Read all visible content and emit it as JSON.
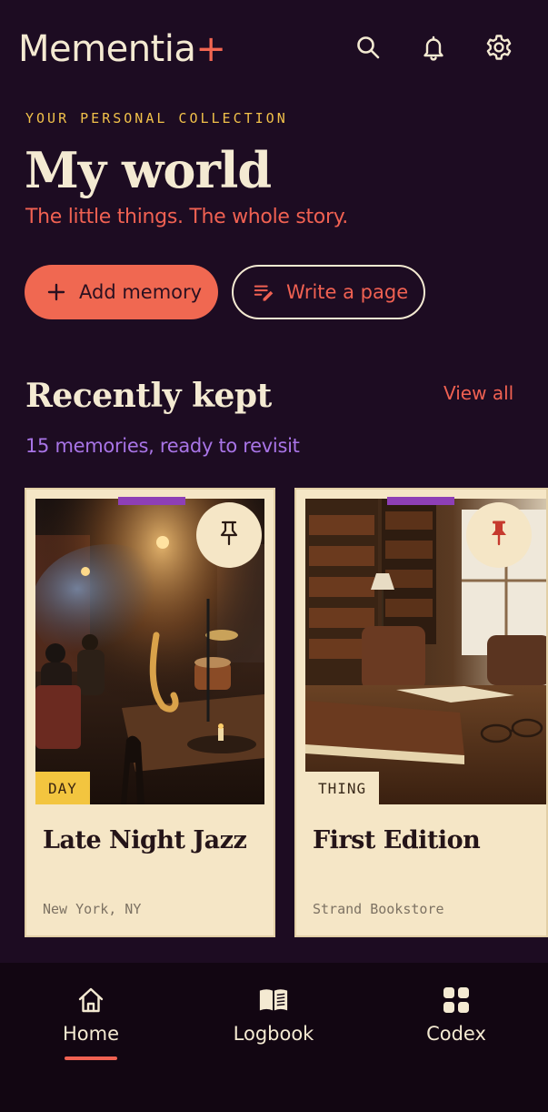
{
  "app": {
    "logo_text": "Mementia",
    "logo_plus": "+"
  },
  "header": {
    "icons": [
      "search-icon",
      "bell-icon",
      "gear-icon"
    ]
  },
  "hero": {
    "eyebrow": "YOUR PERSONAL COLLECTION",
    "title": "My world",
    "subtitle": "The little things. The whole story."
  },
  "actions": {
    "add_memory_label": "Add memory",
    "write_page_label": "Write a page"
  },
  "recent": {
    "title": "Recently kept",
    "view_all_label": "View all",
    "subtitle": "15 memories, ready to revisit",
    "cards": [
      {
        "tag": "DAY",
        "title": "Late Night Jazz",
        "location": "New York, NY",
        "pinned": false
      },
      {
        "tag": "THING",
        "title": "First Edition",
        "location": "Strand Bookstore",
        "pinned": true
      }
    ]
  },
  "nav": {
    "items": [
      {
        "label": "Home",
        "icon": "home-icon",
        "active": true
      },
      {
        "label": "Logbook",
        "icon": "book-icon",
        "active": false
      },
      {
        "label": "Codex",
        "icon": "grid-icon",
        "active": false
      }
    ]
  },
  "colors": {
    "background": "#1d0c22",
    "accent": "#f06152",
    "eyebrow": "#f1c14a",
    "secondary_text": "#a874e6",
    "card": "#f5e6c6",
    "nav_background": "#120612"
  }
}
